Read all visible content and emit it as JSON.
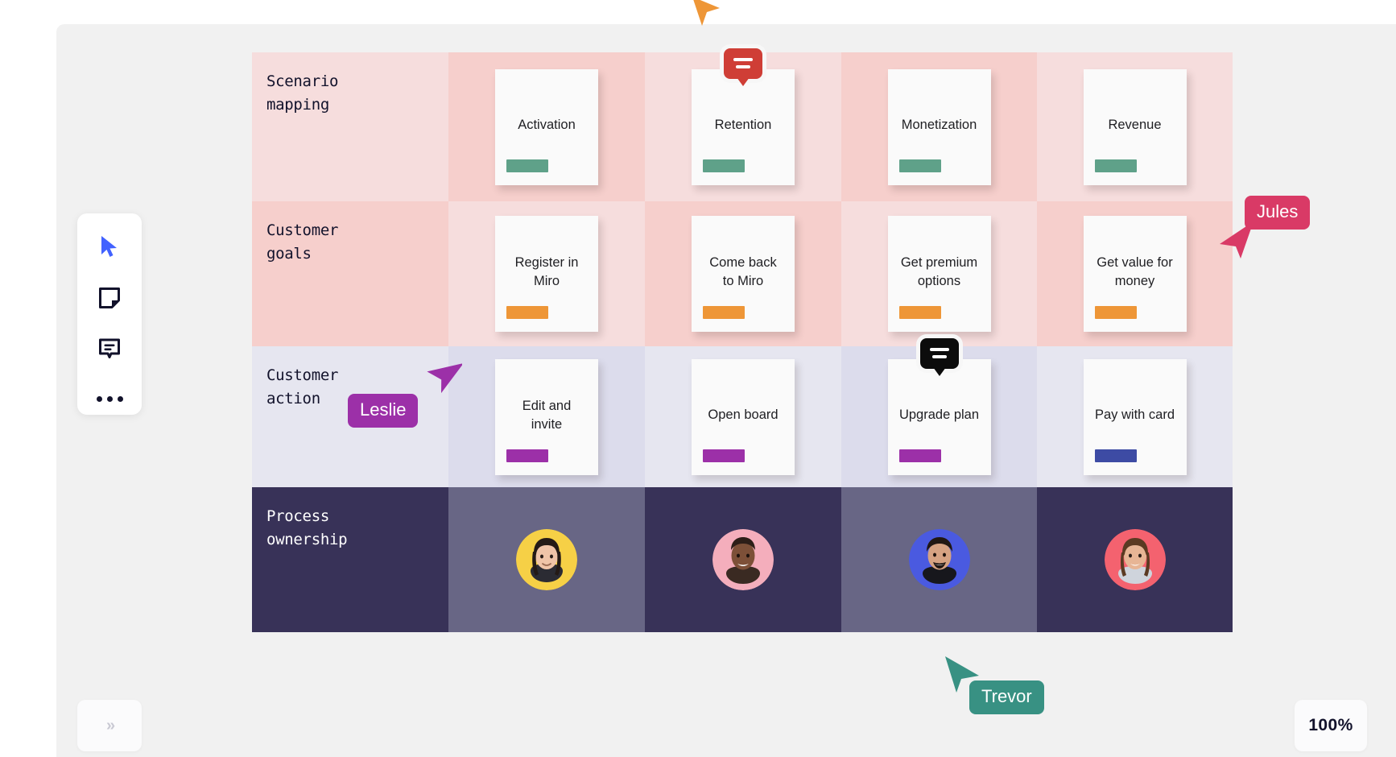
{
  "board": {
    "background_color": "#f1f1f1",
    "zoom_level": "100%",
    "expand_icon": "double-chevron-right-icon"
  },
  "toolbar": {
    "items": [
      {
        "icon": "cursor-select-icon",
        "color": "#4262ff"
      },
      {
        "icon": "sticky-note-icon",
        "color": "#12122b"
      },
      {
        "icon": "comment-icon",
        "color": "#12122b"
      },
      {
        "icon": "more-options-icon",
        "color": "#12122b"
      }
    ]
  },
  "grid": {
    "rows": [
      {
        "label": "Scenario\nmapping",
        "label_bg": "#f6dddd",
        "cards": [
          {
            "text": "Activation",
            "bar_color": "#5fa189",
            "bubble": null
          },
          {
            "text": "Retention",
            "bar_color": "#5fa189",
            "bubble": {
              "color": "#cf3e36",
              "icon": "comment-icon"
            }
          },
          {
            "text": "Monetization",
            "bar_color": "#5fa189",
            "bubble": null
          },
          {
            "text": "Revenue",
            "bar_color": "#5fa189",
            "bubble": null
          }
        ]
      },
      {
        "label": "Customer\ngoals",
        "label_bg": "#f6cfcc",
        "cards": [
          {
            "text": "Register in\nMiro",
            "bar_color": "#ee9637",
            "bubble": null
          },
          {
            "text": "Come back\nto Miro",
            "bar_color": "#ee9637",
            "bubble": null
          },
          {
            "text": "Get premium\noptions",
            "bar_color": "#ee9637",
            "bubble": null
          },
          {
            "text": "Get value for\nmoney",
            "bar_color": "#ee9637",
            "bubble": null
          }
        ]
      },
      {
        "label": "Customer\naction",
        "label_bg": "#e6e6f0",
        "cards": [
          {
            "text": "Edit and\ninvite",
            "bar_color": "#9c30a8",
            "bubble": null
          },
          {
            "text": "Open board",
            "bar_color": "#9c30a8",
            "bubble": null
          },
          {
            "text": "Upgrade plan",
            "bar_color": "#9c30a8",
            "bubble": {
              "color": "#0c0c0c",
              "icon": "comment-icon"
            }
          },
          {
            "text": "Pay with card",
            "bar_color": "#3d4ba4",
            "bubble": null
          }
        ]
      },
      {
        "label": "Process\nownership",
        "label_bg": "#383258",
        "avatars": [
          {
            "name": "avatar-owner-1",
            "ring_color": "#f6d046",
            "skin": "#f0c4a8",
            "hair": "#241a16",
            "shirt": "#2b2b33"
          },
          {
            "name": "avatar-owner-2",
            "ring_color": "#f4aebc",
            "skin": "#7d5038",
            "hair": "#2d1e18",
            "shirt": "#3a2a22"
          },
          {
            "name": "avatar-owner-3",
            "ring_color": "#4a5ae0",
            "skin": "#d6a282",
            "hair": "#211713",
            "shirt": "#17171c"
          },
          {
            "name": "avatar-owner-4",
            "ring_color": "#f4626f",
            "skin": "#e7b595",
            "hair": "#5b3a22",
            "shirt": "#cfd4dc"
          }
        ]
      }
    ]
  },
  "collaborators": [
    {
      "name": "Jules",
      "color": "#d93a66",
      "cursor": "pointer-arrow-icon"
    },
    {
      "name": "Leslie",
      "color": "#9c30a8",
      "cursor": "pointer-arrow-icon"
    },
    {
      "name": "Trevor",
      "color": "#389183",
      "cursor": "pointer-arrow-icon"
    },
    {
      "name": "",
      "color": "#ee9637",
      "cursor": "pointer-arrow-icon"
    }
  ]
}
